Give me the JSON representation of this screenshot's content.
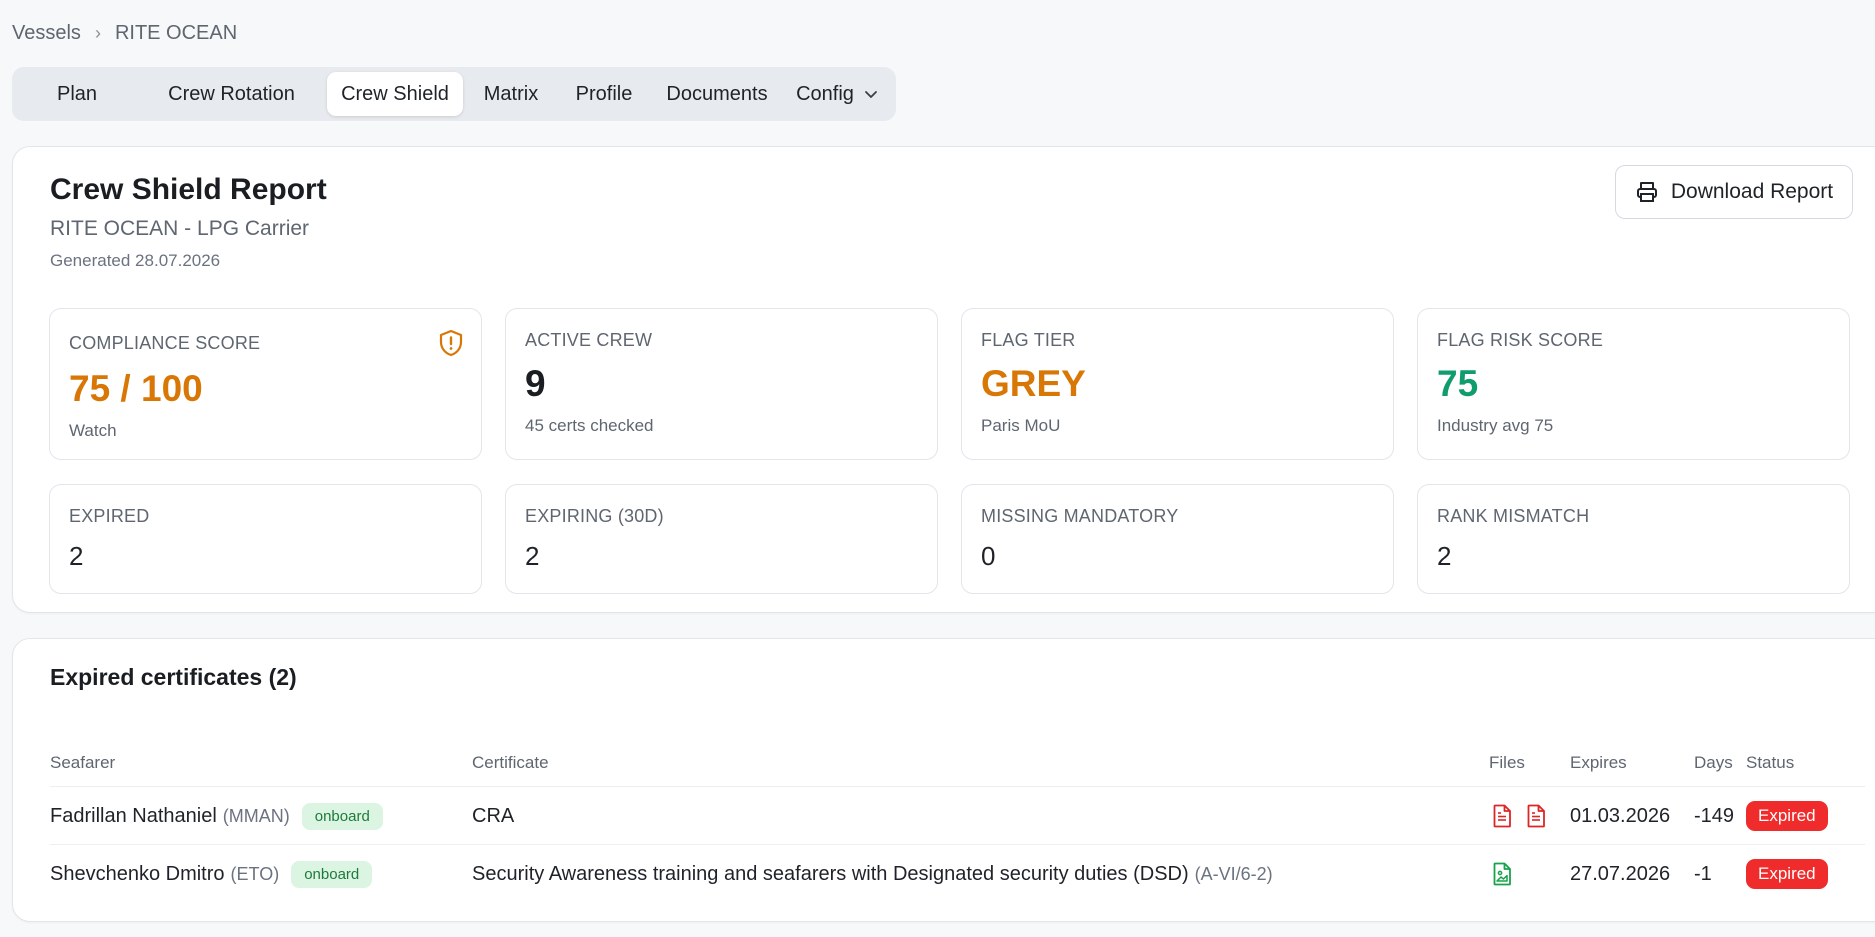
{
  "breadcrumb": {
    "root": "Vessels",
    "current": "RITE OCEAN"
  },
  "tabs": [
    {
      "label": "Plan"
    },
    {
      "label": "Crew Rotation"
    },
    {
      "label": "Crew Shield",
      "active": true
    },
    {
      "label": "Matrix"
    },
    {
      "label": "Profile"
    },
    {
      "label": "Documents"
    },
    {
      "label": "Config"
    }
  ],
  "report": {
    "title": "Crew Shield Report",
    "subtitle": "RITE OCEAN - LPG Carrier",
    "generated": "Generated 28.07.2026",
    "download_label": "Download Report"
  },
  "stats": {
    "compliance": {
      "label": "COMPLIANCE SCORE",
      "value": "75 / 100",
      "note": "Watch",
      "color": "#d97706"
    },
    "active_crew": {
      "label": "ACTIVE CREW",
      "value": "9",
      "note": "45 certs checked"
    },
    "flag_tier": {
      "label": "FLAG TIER",
      "value": "GREY",
      "note": "Paris MoU",
      "color": "#d97706"
    },
    "flag_risk": {
      "label": "FLAG RISK SCORE",
      "value": "75",
      "note": "Industry avg 75",
      "color": "#0f9d6e"
    },
    "expired": {
      "label": "EXPIRED",
      "value": "2"
    },
    "expiring": {
      "label": "EXPIRING (30D)",
      "value": "2"
    },
    "missing": {
      "label": "MISSING MANDATORY",
      "value": "0"
    },
    "rank_mismatch": {
      "label": "RANK MISMATCH",
      "value": "2"
    }
  },
  "expired_certs": {
    "title": "Expired certificates (2)",
    "columns": {
      "seafarer": "Seafarer",
      "certificate": "Certificate",
      "files": "Files",
      "expires": "Expires",
      "days": "Days",
      "status": "Status"
    },
    "rows": [
      {
        "name": "Fadrillan Nathaniel",
        "rank": "(MMAN)",
        "badge": "onboard",
        "certificate": "CRA",
        "code": "",
        "expires": "01.03.2026",
        "days": "-149",
        "status": "Expired",
        "files": [
          "pdf-file-icon",
          "pdf-file-icon"
        ]
      },
      {
        "name": "Shevchenko Dmitro",
        "rank": "(ETO)",
        "badge": "onboard",
        "certificate": "Security Awareness training and seafarers with Designated security duties (DSD)",
        "code": "(A-VI/6-2)",
        "expires": "27.07.2026",
        "days": "-1",
        "status": "Expired",
        "files": [
          "image-file-icon"
        ]
      }
    ]
  }
}
